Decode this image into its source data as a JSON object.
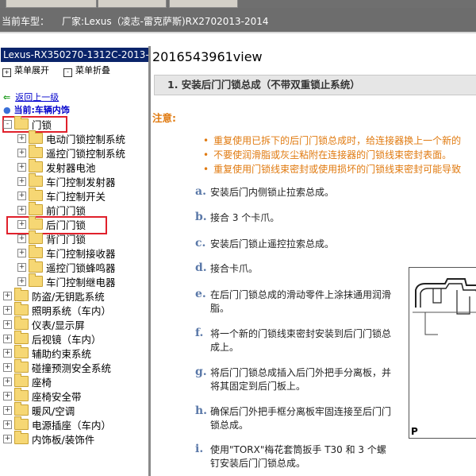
{
  "header": {
    "label": "当前车型：",
    "value": "厂家:Lexus（凌志-雷克萨斯)RX2702013-2014"
  },
  "left": {
    "title": "Lexus-RX350270-1312C-2013-2",
    "expand_label": "菜单展开",
    "collapse_label": "菜单折叠",
    "back_label": "返回上一级",
    "current_label": "当前:车辆内饰",
    "tree": [
      {
        "label": "门锁",
        "level": 0,
        "state": "-",
        "highlighted": true
      },
      {
        "label": "电动门锁控制系统",
        "level": 1,
        "state": "+"
      },
      {
        "label": "遥控门锁控制系统",
        "level": 1,
        "state": "+"
      },
      {
        "label": "发射器电池",
        "level": 1,
        "state": "+"
      },
      {
        "label": "车门控制发射器",
        "level": 1,
        "state": "+"
      },
      {
        "label": "车门控制开关",
        "level": 1,
        "state": "+"
      },
      {
        "label": "前门门锁",
        "level": 1,
        "state": "+"
      },
      {
        "label": "后门门锁",
        "level": 1,
        "state": "+",
        "highlighted": true
      },
      {
        "label": "背门门锁",
        "level": 1,
        "state": "+"
      },
      {
        "label": "车门控制接收器",
        "level": 1,
        "state": "+"
      },
      {
        "label": "遥控门锁蜂鸣器",
        "level": 1,
        "state": "+"
      },
      {
        "label": "车门控制继电器",
        "level": 1,
        "state": "+"
      },
      {
        "label": "防盗/无钥匙系统",
        "level": 0,
        "state": "+"
      },
      {
        "label": "照明系统（车内）",
        "level": 0,
        "state": "+"
      },
      {
        "label": "仪表/显示屏",
        "level": 0,
        "state": "+"
      },
      {
        "label": "后视镜（车内）",
        "level": 0,
        "state": "+"
      },
      {
        "label": "辅助约束系统",
        "level": 0,
        "state": "+"
      },
      {
        "label": "碰撞预测安全系统",
        "level": 0,
        "state": "+"
      },
      {
        "label": "座椅",
        "level": 0,
        "state": "+"
      },
      {
        "label": "座椅安全带",
        "level": 0,
        "state": "+"
      },
      {
        "label": "暖风/空调",
        "level": 0,
        "state": "+"
      },
      {
        "label": "电源插座（车内）",
        "level": 0,
        "state": "+"
      },
      {
        "label": "内饰板/装饰件",
        "level": 0,
        "state": "+"
      }
    ]
  },
  "doc": {
    "id": "2016543961view",
    "section_title": "1. 安装后门门锁总成（不带双重锁止系统）",
    "note_label": "注意:",
    "notes": [
      "重复使用已拆下的后门门锁总成时，给连接器换上一个新的",
      "不要使润滑脂或灰尘粘附在连接器的门锁线束密封表面。",
      "重复使用门锁线束密封或使用损坏的门锁线束密封可能导致"
    ],
    "steps": [
      {
        "letter": "a.",
        "text": "安装后门内侧锁止拉索总成。"
      },
      {
        "letter": "b.",
        "text": "接合 3 个卡爪。"
      },
      {
        "letter": "c.",
        "text": "安装后门锁止遥控拉索总成。"
      },
      {
        "letter": "d.",
        "text": "接合卡爪。"
      },
      {
        "letter": "e.",
        "text": "在后门门锁总成的滑动零件上涂抹通用润滑脂。"
      },
      {
        "letter": "f.",
        "text": "将一个新的门锁线束密封安装到后门门锁总成上。"
      },
      {
        "letter": "g.",
        "text": "将后门门锁总成插入后门外把手分离板，并将其固定到后门板上。"
      },
      {
        "letter": "h.",
        "text": "确保后门外把手框分离板牢固连接至后门门锁总成。"
      },
      {
        "letter": "i.",
        "text": "使用\"TORX\"梅花套筒扳手 T30 和 3 个螺钉安装后门门锁总成。"
      }
    ],
    "figure_label": "P"
  },
  "colors": {
    "header_bg": "#6d6d6d",
    "title_bg": "#0a246a",
    "note": "#e07a10",
    "step_letter": "#5a78a8",
    "highlight": "#e0202b"
  }
}
